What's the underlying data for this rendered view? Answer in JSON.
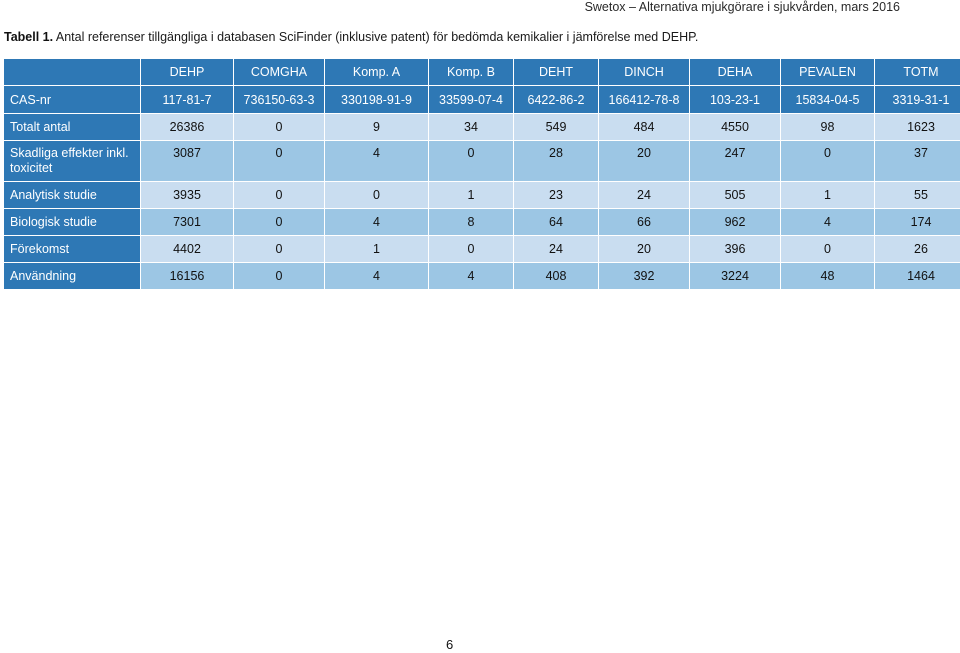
{
  "header": {
    "running_title": "Swetox – Alternativa mjukgörare i sjukvården, mars 2016"
  },
  "caption": {
    "label": "Tabell 1.",
    "text": " Antal referenser tillgängliga i databasen SciFinder (inklusive patent) för bedömda kemikalier i jämförelse med DEHP."
  },
  "table": {
    "columns": [
      "DEHP",
      "COMGHA",
      "Komp. A",
      "Komp. B",
      "DEHT",
      "DINCH",
      "DEHA",
      "PEVALEN",
      "TOTM"
    ],
    "rows": [
      {
        "label": "CAS-nr",
        "values": [
          "117-81-7",
          "736150-63-3",
          "330198-91-9",
          "33599-07-4",
          "6422-86-2",
          "166412-78-8",
          "103-23-1",
          "15834-04-5",
          "3319-31-1"
        ]
      },
      {
        "label": "Totalt antal",
        "values": [
          "26386",
          "0",
          "9",
          "34",
          "549",
          "484",
          "4550",
          "98",
          "1623"
        ]
      },
      {
        "label": "Skadliga effekter inkl. toxicitet",
        "values": [
          "3087",
          "0",
          "4",
          "0",
          "28",
          "20",
          "247",
          "0",
          "37"
        ]
      },
      {
        "label": "Analytisk studie",
        "values": [
          "3935",
          "0",
          "0",
          "1",
          "23",
          "24",
          "505",
          "1",
          "55"
        ]
      },
      {
        "label": "Biologisk studie",
        "values": [
          "7301",
          "0",
          "4",
          "8",
          "64",
          "66",
          "962",
          "4",
          "174"
        ]
      },
      {
        "label": "Förekomst",
        "values": [
          "4402",
          "0",
          "1",
          "0",
          "24",
          "20",
          "396",
          "0",
          "26"
        ]
      },
      {
        "label": "Användning",
        "values": [
          "16156",
          "0",
          "4",
          "4",
          "408",
          "392",
          "3224",
          "48",
          "1464"
        ]
      }
    ]
  },
  "footer": {
    "page_number": "6"
  },
  "colors": {
    "header_blue": "#2e78b5",
    "row_light": "#c9ddf0",
    "row_dark": "#9cc6e4"
  }
}
